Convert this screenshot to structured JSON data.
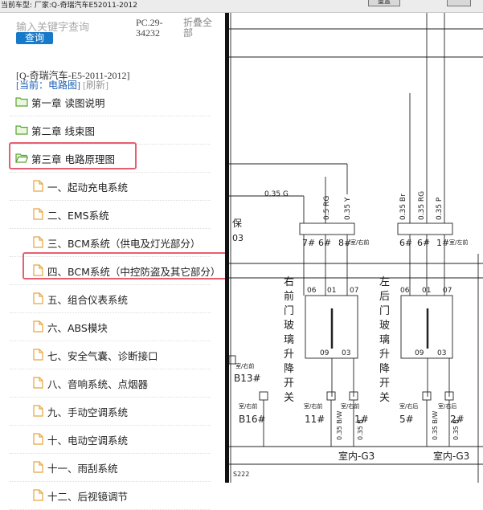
{
  "topbar": {
    "car_label": "当前车型:  厂家:Q-奇瑞汽车E52011-2012",
    "btn_label": "重置"
  },
  "search": {
    "placeholder": "输入关键字查询",
    "button": "查询"
  },
  "doc_code": "PC.29-34232",
  "collapse_all": "折叠全部",
  "title": "[Q-奇瑞汽车-E5-2011-2012]",
  "current_label": "[当前：电路图]",
  "refresh": "[刷新]",
  "chapters": [
    {
      "label": "第一章 读图说明"
    },
    {
      "label": "第二章 线束图"
    },
    {
      "label": "第三章 电路原理图",
      "highlighted": true
    }
  ],
  "sections": [
    {
      "label": "一、起动充电系统"
    },
    {
      "label": "二、EMS系统"
    },
    {
      "label": "三、BCM系统（供电及灯光部分）"
    },
    {
      "label": "四、BCM系统（中控防盗及其它部分）",
      "highlighted": true
    },
    {
      "label": "五、组合仪表系统"
    },
    {
      "label": "六、ABS模块"
    },
    {
      "label": "七、安全气囊、诊断接口"
    },
    {
      "label": "八、音响系统、点烟器"
    },
    {
      "label": "九、手动空调系统"
    },
    {
      "label": "十、电动空调系统"
    },
    {
      "label": "十一、雨刮系统"
    },
    {
      "label": "十二、后视镜调节"
    }
  ],
  "diagram": {
    "wire_035g": "0.35 G",
    "wire_rg": "0.5 RG",
    "wire_y": "0.35 Y",
    "wire_br": "0.35 Br",
    "wire_rg2": "0.35 RG",
    "wire_p": "0.35 P",
    "bao": "保",
    "bao03": "03",
    "pin7": "7#",
    "pin6a": "6#",
    "pin8": "8#",
    "tag_right": "室/右前",
    "pin6b": "6#",
    "pin6c": "6#",
    "pin1": "1#",
    "tag_left": "室/左前",
    "pin06a": "06",
    "pin01a": "01",
    "pin07a": "07",
    "pin09a": "09",
    "pin03a": "03",
    "pin06b": "06",
    "pin01b": "01",
    "pin07b": "07",
    "pin09b": "09",
    "pin03b": "03",
    "sw_right": [
      "右",
      "前",
      "门",
      "玻",
      "璃",
      "升",
      "降",
      "开",
      "关"
    ],
    "sw_left": [
      "左",
      "后",
      "门",
      "玻",
      "璃",
      "升",
      "降",
      "开",
      "关"
    ],
    "b13": "B13#",
    "b16": "B16#",
    "b13_tag": "室/右前",
    "b16_tag": "室/右前",
    "p11": "11#",
    "p1b": "1#",
    "p5": "5#",
    "p2": "2#",
    "p11_tag": "室/右前",
    "p1b_tag": "室/右前",
    "p5_tag": "室/右后",
    "p2_tag": "室/右后",
    "w_bw1": "0.35 B/W",
    "w_b1": "0.35 B",
    "w_bw2": "0.35 B/W",
    "w_b2": "0.35 B",
    "ground1": "室内-G3",
    "ground2": "室内-G3",
    "s222": "S222"
  },
  "colors": {
    "accent": "#1679c9",
    "highlight": "#e65f70",
    "folder": "#5aa531",
    "doc": "#e8a33d"
  }
}
